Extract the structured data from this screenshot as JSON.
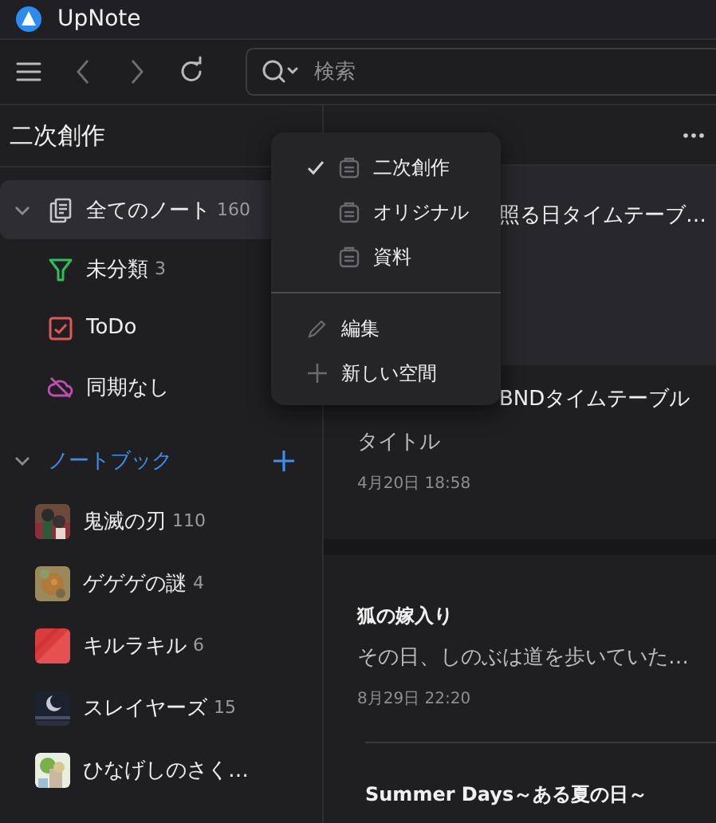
{
  "app": {
    "title": "UpNote"
  },
  "toolbar": {
    "search": {
      "placeholder": "検索"
    }
  },
  "sidebar": {
    "space_title": "二次創作",
    "items": [
      {
        "label": "全てのノート",
        "count": "160",
        "kind": "all",
        "selected": true,
        "expanded": true
      },
      {
        "label": "未分類",
        "count": "3",
        "kind": "filter",
        "selected": false
      },
      {
        "label": "ToDo",
        "kind": "todo",
        "selected": false
      },
      {
        "label": "同期なし",
        "kind": "nosync",
        "selected": false
      }
    ],
    "notebooks": {
      "label": "ノートブック",
      "expanded": true,
      "items": [
        {
          "name": "鬼滅の刃",
          "count": "110",
          "kind": "picture"
        },
        {
          "name": "ゲゲゲの謎",
          "count": "4",
          "kind": "picture"
        },
        {
          "name": "キルラキル",
          "count": "6",
          "kind": "picture"
        },
        {
          "name": "スレイヤーズ",
          "count": "15",
          "kind": "picture"
        },
        {
          "name": "ひなげしのさく…",
          "kind": "picture"
        }
      ]
    }
  },
  "note_groups": [
    [
      {
        "title": "照る日タイムテーブ…",
        "selected": true,
        "covered": true
      },
      {
        "title": "BNDタイムテーブル",
        "preview": "タイトル",
        "date": "4月20日 18:58",
        "selected": false,
        "covered": true
      }
    ],
    [
      {
        "title": "狐の嫁入り",
        "preview": "その日、しのぶは道を歩いていた…",
        "date": "8月29日 22:20",
        "selected": false,
        "covered": false
      },
      {
        "title": "Summer Days～ある夏の日～",
        "selected": false,
        "covered": false
      }
    ]
  ],
  "space_menu": {
    "spaces": [
      {
        "label": "二次創作",
        "selected": true
      },
      {
        "label": "オリジナル",
        "selected": false
      },
      {
        "label": "資料",
        "selected": false
      }
    ],
    "actions": [
      {
        "label": "編集",
        "kind": "edit"
      },
      {
        "label": "新しい空間",
        "kind": "new"
      }
    ]
  }
}
